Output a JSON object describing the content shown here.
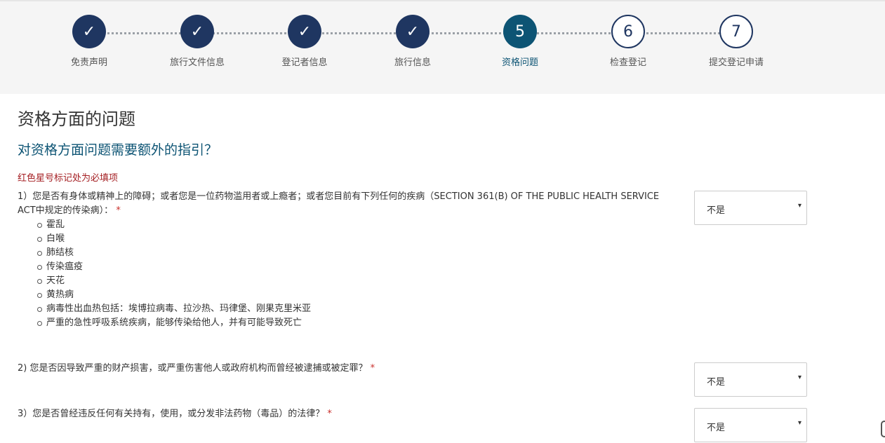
{
  "steps": [
    {
      "label": "免责声明",
      "symbol": "✓",
      "state": "done"
    },
    {
      "label": "旅行文件信息",
      "symbol": "✓",
      "state": "done"
    },
    {
      "label": "登记者信息",
      "symbol": "✓",
      "state": "done"
    },
    {
      "label": "旅行信息",
      "symbol": "✓",
      "state": "done"
    },
    {
      "label": "资格问题",
      "symbol": "5",
      "state": "current"
    },
    {
      "label": "检查登记",
      "symbol": "6",
      "state": "todo"
    },
    {
      "label": "提交登记申请",
      "symbol": "7",
      "state": "todo"
    }
  ],
  "page_title": "资格方面的问题",
  "help_link": "对资格方面问题需要额外的指引？",
  "required_note": "红色星号标记处为必填项",
  "questions": [
    {
      "text": "1）您是否有身体或精神上的障碍；或者您是一位药物滥用者或上瘾者；或者您目前有下列任何的疾病（SECTION 361(B) OF THE PUBLIC HEALTH SERVICE ACT中规定的传染病）：",
      "asterisk": "*",
      "items": [
        "霍乱",
        "白喉",
        "肺结核",
        "传染瘟疫",
        "天花",
        "黄热病",
        "病毒性出血热包括：埃博拉病毒、拉沙热、玛律堡、刚果克里米亚",
        "严重的急性呼吸系统疾病，能够传染给他人，并有可能导致死亡"
      ],
      "answer": "不是"
    },
    {
      "text": "2) 您是否因导致严重的财产损害，或严重伤害他人或政府机构而曾经被逮捕或被定罪？",
      "asterisk": "*",
      "answer": "不是"
    },
    {
      "text": "3）您是否曾经违反任何有关持有，使用，或分发非法药物（毒品）的法律？",
      "asterisk": "*",
      "answer": "不是"
    }
  ],
  "select_caret": "▾",
  "colors": {
    "done": "#1f3661",
    "current": "#0d5474",
    "link": "#0d5474",
    "required": "#a41e22"
  }
}
